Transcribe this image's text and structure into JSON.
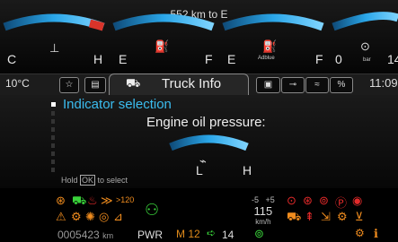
{
  "top": {
    "range_text": "552 km to E",
    "gauges": [
      {
        "left": "C",
        "right": "H"
      },
      {
        "left": "E",
        "right": "F"
      },
      {
        "left": "E",
        "right": "F",
        "icon_label": "Adblue"
      },
      {
        "left": "0",
        "right": "14",
        "icon_label": "bar"
      }
    ]
  },
  "tabbar": {
    "temperature": "10°C",
    "active_tab": "Truck Info",
    "time": "11:09"
  },
  "panel": {
    "title": "Indicator selection",
    "gauge_title": "Engine oil pressure:",
    "gauge_low": "L",
    "gauge_high": "H",
    "hold_prefix": "Hold ",
    "hold_ok": "OK",
    "hold_suffix": " to select"
  },
  "bottom": {
    "speed_limit_low": "-5",
    "speed_limit_high": "+5",
    "speed": "115",
    "speed_unit": "km/h",
    "odometer": "0005423",
    "odometer_unit": "km",
    "power_mode": "PWR",
    "gear_text": "M 12",
    "next_gear": "14",
    "cruise_limit": ">120"
  },
  "colors": {
    "gauge_blue": "#2aa6e8",
    "gauge_red": "#d9342a",
    "accent_text": "#3bbdf0",
    "warn_orange": "#f08c1e",
    "warn_red": "#e42a2a",
    "warn_green": "#39d23a"
  }
}
